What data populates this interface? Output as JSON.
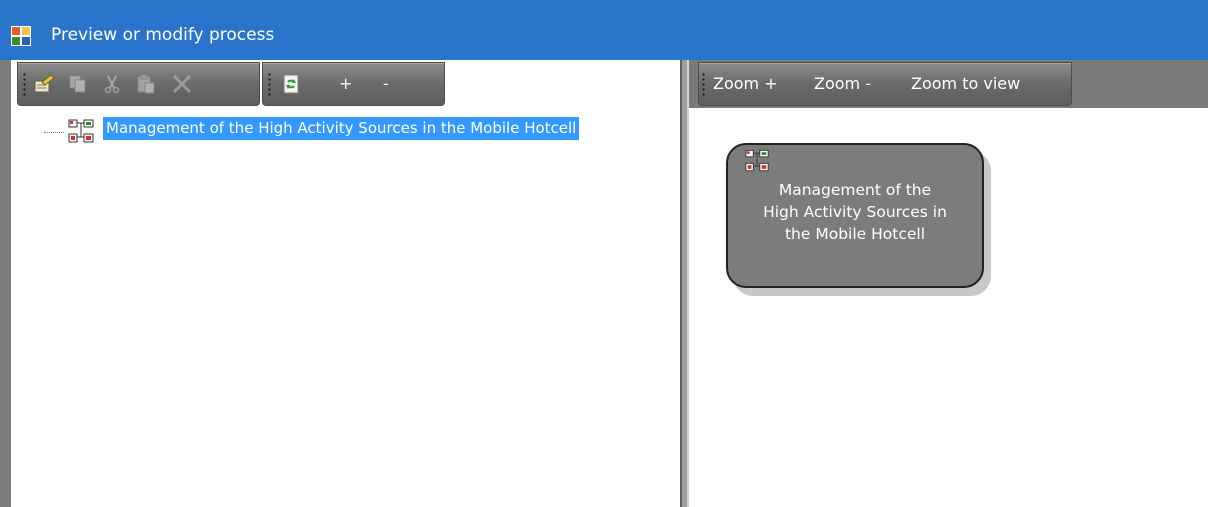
{
  "window": {
    "title": "Preview or modify process",
    "app_icon": "process-window-icon"
  },
  "left_toolbar": {
    "buttons": [
      {
        "icon": "properties-edit-icon",
        "enabled": true
      },
      {
        "icon": "copy-icon",
        "enabled": false
      },
      {
        "icon": "cut-icon",
        "enabled": false
      },
      {
        "icon": "paste-icon",
        "enabled": false
      },
      {
        "icon": "delete-icon",
        "enabled": false
      },
      {
        "icon": "refresh-icon",
        "enabled": true
      }
    ],
    "expand_label": "+",
    "collapse_label": "-"
  },
  "tree": {
    "items": [
      {
        "label": "Management of the High Activity Sources in the Mobile Hotcell",
        "icon": "process-flow-icon",
        "selected": true
      }
    ]
  },
  "right_toolbar": {
    "zoom_in": "Zoom +",
    "zoom_out": "Zoom -",
    "zoom_to_view": "Zoom to view"
  },
  "diagram": {
    "node": {
      "line1": "Management of the",
      "line2": "High Activity Sources in",
      "line3": "the Mobile Hotcell",
      "icon": "process-flow-icon"
    }
  },
  "colors": {
    "titlebar": "#2b74cc",
    "selection": "#3399ff",
    "toolbar": "#6a6a6a",
    "node_fill": "#7c7c7c"
  }
}
